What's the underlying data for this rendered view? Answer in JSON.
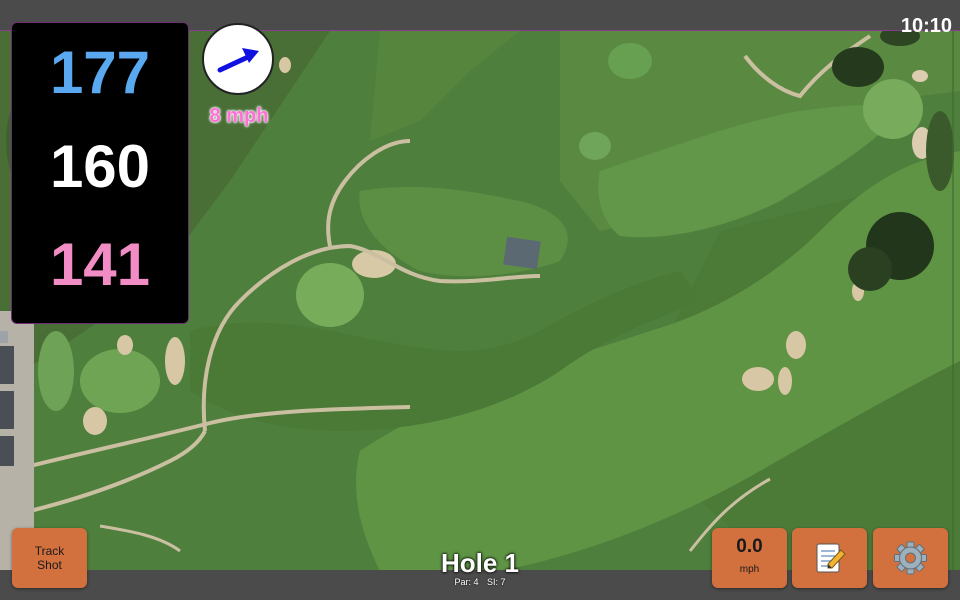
{
  "status_bar": {
    "time": "10:10"
  },
  "distances": {
    "back": "177",
    "middle": "160",
    "front": "141"
  },
  "wind": {
    "speed_label": "8 mph",
    "direction_icon": "arrow-icon"
  },
  "hole": {
    "title": "Hole 1",
    "par_label": "Par: 4",
    "si_label": "SI: 7"
  },
  "buttons": {
    "track_line1": "Track",
    "track_line2": "Shot",
    "speed_value": "0.0",
    "speed_unit": "mph",
    "notes_icon": "notes-icon",
    "settings_icon": "gear-icon"
  },
  "colors": {
    "back_distance": "#5aa9f0",
    "middle_distance": "#ffffff",
    "front_distance": "#f28cc4",
    "button": "#d2703e",
    "wind_text": "#ff6fd8",
    "wind_arrow": "#1010e0"
  }
}
